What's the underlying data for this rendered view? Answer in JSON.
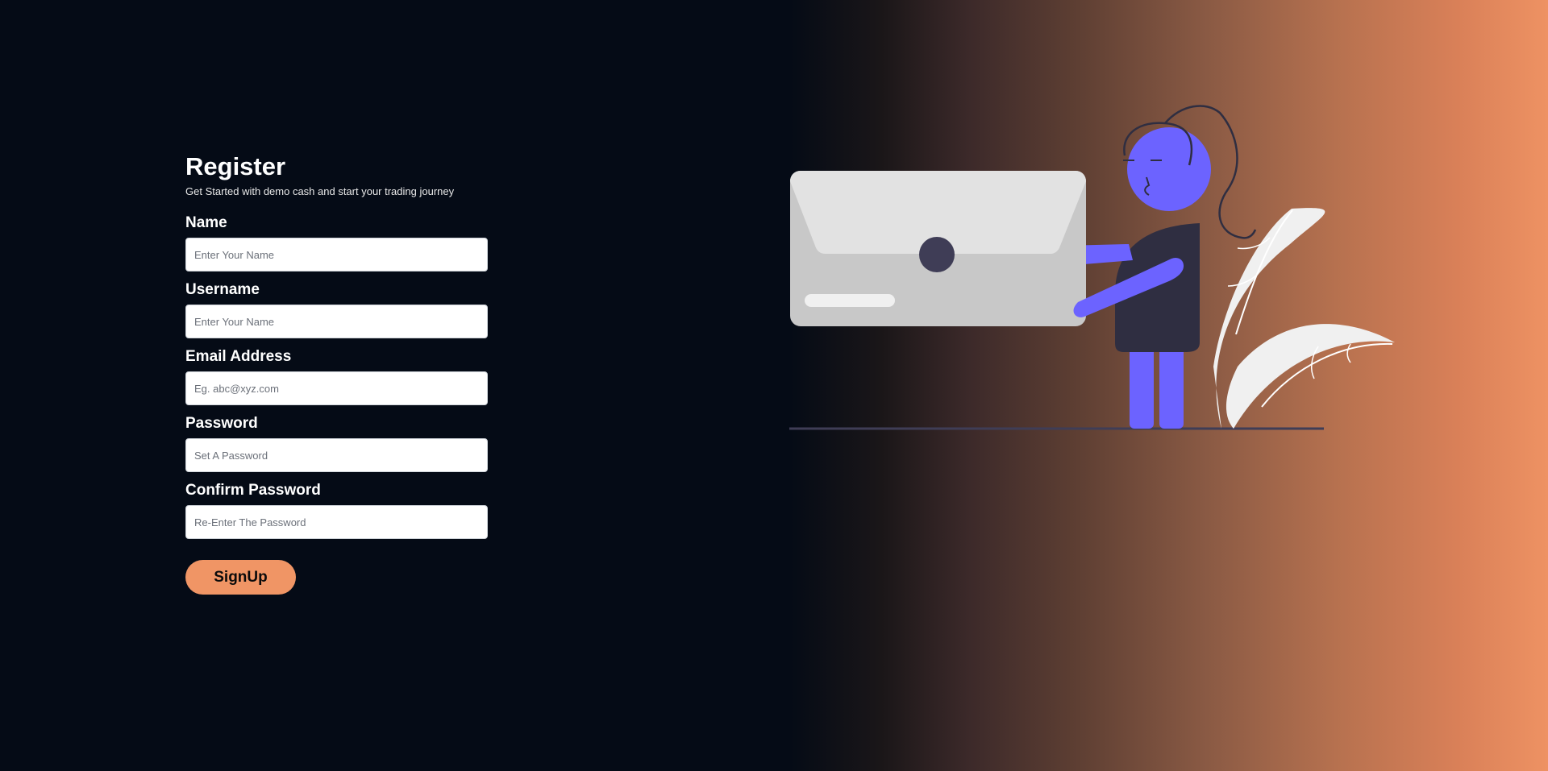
{
  "form": {
    "title": "Register",
    "subtitle": "Get Started with demo cash and start your trading journey",
    "fields": [
      {
        "label": "Name",
        "placeholder": "Enter Your Name"
      },
      {
        "label": "Username",
        "placeholder": "Enter Your Name"
      },
      {
        "label": "Email Address",
        "placeholder": "Eg. abc@xyz.com"
      },
      {
        "label": "Password",
        "placeholder": "Set A Password"
      },
      {
        "label": "Confirm Password",
        "placeholder": "Re-Enter The Password"
      }
    ],
    "submit_label": "SignUp"
  },
  "colors": {
    "background": "#050b16",
    "accent": "#f09565",
    "figure": "#6c63ff",
    "shirt": "#2f2e41",
    "envelope": "#e2e2e2"
  },
  "illustration": {
    "icon": "person-holding-envelope-illustration"
  }
}
